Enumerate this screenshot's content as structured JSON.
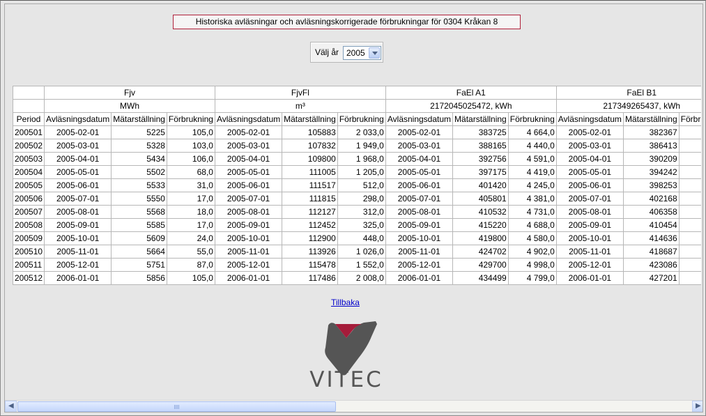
{
  "title": "Historiska avläsningar och avläsningskorrigerade förbrukningar för 0304 Kråkan 8",
  "year_select": {
    "label": "Välj år",
    "value": "2005"
  },
  "groups": [
    {
      "name": "Fjv",
      "unit": "MWh"
    },
    {
      "name": "FjvFl",
      "unit": "m³"
    },
    {
      "name": "FaEl A1",
      "unit": "2172045025472, kWh"
    },
    {
      "name": "FaEl B1",
      "unit": "217349265437, kWh"
    }
  ],
  "column_headers": {
    "period": "Period",
    "date": "Avläsningsdatum",
    "meter": "Mätarställning",
    "usage": "Förbrukning"
  },
  "rows": [
    {
      "period": "200501",
      "cells": [
        [
          "2005-02-01",
          "5225",
          "105,0"
        ],
        [
          "2005-02-01",
          "105883",
          "2 033,0"
        ],
        [
          "2005-02-01",
          "383725",
          "4 664,0"
        ],
        [
          "2005-02-01",
          "382367"
        ]
      ]
    },
    {
      "period": "200502",
      "cells": [
        [
          "2005-03-01",
          "5328",
          "103,0"
        ],
        [
          "2005-03-01",
          "107832",
          "1 949,0"
        ],
        [
          "2005-03-01",
          "388165",
          "4 440,0"
        ],
        [
          "2005-03-01",
          "386413"
        ]
      ]
    },
    {
      "period": "200503",
      "cells": [
        [
          "2005-04-01",
          "5434",
          "106,0"
        ],
        [
          "2005-04-01",
          "109800",
          "1 968,0"
        ],
        [
          "2005-04-01",
          "392756",
          "4 591,0"
        ],
        [
          "2005-04-01",
          "390209"
        ]
      ]
    },
    {
      "period": "200504",
      "cells": [
        [
          "2005-05-01",
          "5502",
          "68,0"
        ],
        [
          "2005-05-01",
          "111005",
          "1 205,0"
        ],
        [
          "2005-05-01",
          "397175",
          "4 419,0"
        ],
        [
          "2005-05-01",
          "394242"
        ]
      ]
    },
    {
      "period": "200505",
      "cells": [
        [
          "2005-06-01",
          "5533",
          "31,0"
        ],
        [
          "2005-06-01",
          "111517",
          "512,0"
        ],
        [
          "2005-06-01",
          "401420",
          "4 245,0"
        ],
        [
          "2005-06-01",
          "398253"
        ]
      ]
    },
    {
      "period": "200506",
      "cells": [
        [
          "2005-07-01",
          "5550",
          "17,0"
        ],
        [
          "2005-07-01",
          "111815",
          "298,0"
        ],
        [
          "2005-07-01",
          "405801",
          "4 381,0"
        ],
        [
          "2005-07-01",
          "402168"
        ]
      ]
    },
    {
      "period": "200507",
      "cells": [
        [
          "2005-08-01",
          "5568",
          "18,0"
        ],
        [
          "2005-08-01",
          "112127",
          "312,0"
        ],
        [
          "2005-08-01",
          "410532",
          "4 731,0"
        ],
        [
          "2005-08-01",
          "406358"
        ]
      ]
    },
    {
      "period": "200508",
      "cells": [
        [
          "2005-09-01",
          "5585",
          "17,0"
        ],
        [
          "2005-09-01",
          "112452",
          "325,0"
        ],
        [
          "2005-09-01",
          "415220",
          "4 688,0"
        ],
        [
          "2005-09-01",
          "410454"
        ]
      ]
    },
    {
      "period": "200509",
      "cells": [
        [
          "2005-10-01",
          "5609",
          "24,0"
        ],
        [
          "2005-10-01",
          "112900",
          "448,0"
        ],
        [
          "2005-10-01",
          "419800",
          "4 580,0"
        ],
        [
          "2005-10-01",
          "414636"
        ]
      ]
    },
    {
      "period": "200510",
      "cells": [
        [
          "2005-11-01",
          "5664",
          "55,0"
        ],
        [
          "2005-11-01",
          "113926",
          "1 026,0"
        ],
        [
          "2005-11-01",
          "424702",
          "4 902,0"
        ],
        [
          "2005-11-01",
          "418687"
        ]
      ]
    },
    {
      "period": "200511",
      "cells": [
        [
          "2005-12-01",
          "5751",
          "87,0"
        ],
        [
          "2005-12-01",
          "115478",
          "1 552,0"
        ],
        [
          "2005-12-01",
          "429700",
          "4 998,0"
        ],
        [
          "2005-12-01",
          "423086"
        ]
      ]
    },
    {
      "period": "200512",
      "cells": [
        [
          "2006-01-01",
          "5856",
          "105,0"
        ],
        [
          "2006-01-01",
          "117486",
          "2 008,0"
        ],
        [
          "2006-01-01",
          "434499",
          "4 799,0"
        ],
        [
          "2006-01-01",
          "427201"
        ]
      ]
    }
  ],
  "back_link": "Tillbaka",
  "logo": {
    "text": "VITEC",
    "color_red": "#a51c3a",
    "color_gray": "#555555"
  }
}
